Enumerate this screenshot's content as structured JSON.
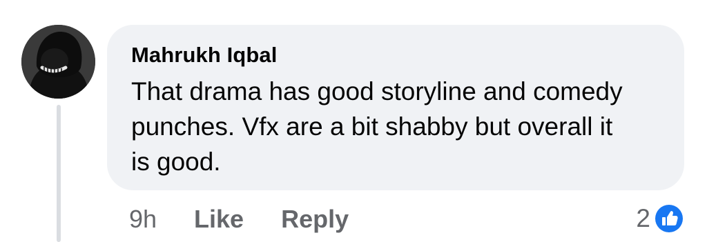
{
  "comment": {
    "author": "Mahrukh Iqbal",
    "text": "That drama has good storyline and comedy punches. Vfx are a bit shabby but overall it is good.",
    "time": "9h",
    "like_label": "Like",
    "reply_label": "Reply",
    "reaction_count": "2",
    "reaction_icon": "like-icon",
    "colors": {
      "bubble": "#f0f2f5",
      "text": "#050505",
      "secondary": "#65676b",
      "like_blue": "#1877f2"
    }
  }
}
